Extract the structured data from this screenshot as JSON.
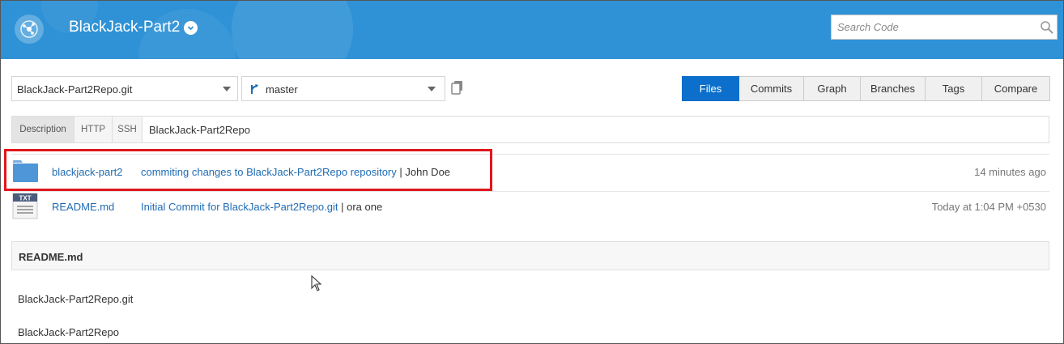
{
  "header": {
    "project_title": "BlackJack-Part2",
    "search_placeholder": "Search Code",
    "brand_color": "#2f92d6"
  },
  "selectors": {
    "repository": "BlackJack-Part2Repo.git",
    "branch": "master"
  },
  "tabs": [
    {
      "label": "Files",
      "active": true
    },
    {
      "label": "Commits",
      "active": false
    },
    {
      "label": "Graph",
      "active": false
    },
    {
      "label": "Branches",
      "active": false
    },
    {
      "label": "Tags",
      "active": false
    },
    {
      "label": "Compare",
      "active": false
    }
  ],
  "clone": {
    "tabs": [
      "Description",
      "HTTP",
      "SSH"
    ],
    "active_tab": "Description",
    "value": "BlackJack-Part2Repo"
  },
  "files": [
    {
      "name": "blackjack-part2",
      "type": "folder",
      "commit_message": "commiting changes to BlackJack-Part2Repo repository",
      "author": "| John Doe",
      "time": "14 minutes ago"
    },
    {
      "name": "README.md",
      "type": "txt",
      "icon_label": "TXT",
      "commit_message": "Initial Commit for BlackJack-Part2Repo.git",
      "author": "| ora one",
      "time": "Today at 1:04 PM +0530"
    }
  ],
  "readme": {
    "title": "README.md",
    "lines": [
      "BlackJack-Part2Repo.git",
      "BlackJack-Part2Repo"
    ]
  },
  "colors": {
    "active_tab": "#0b6fcb",
    "link": "#1f6bb3",
    "highlight": "#e0171c"
  }
}
